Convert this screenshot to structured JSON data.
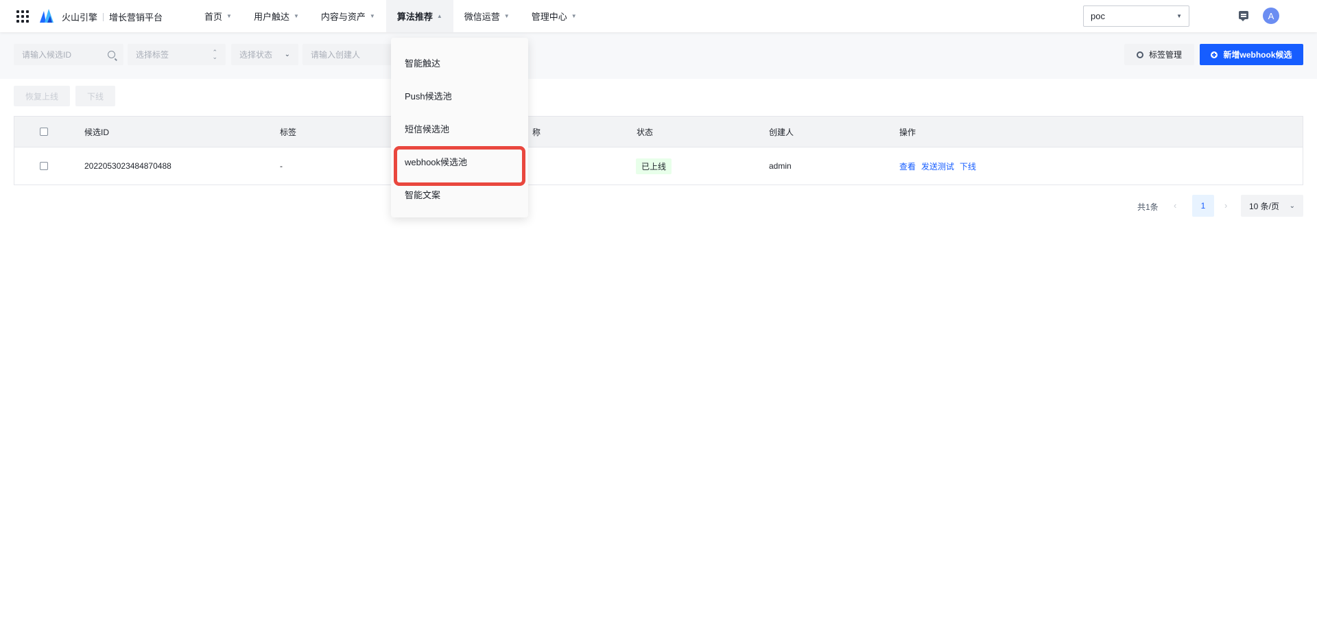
{
  "header": {
    "brand_name": "火山引擎",
    "platform_name": "增长营销平台",
    "nav": [
      {
        "label": "首页"
      },
      {
        "label": "用户触达"
      },
      {
        "label": "内容与资产"
      },
      {
        "label": "算法推荐",
        "active": true
      },
      {
        "label": "微信运营"
      },
      {
        "label": "管理中心"
      }
    ],
    "project_select": "poc",
    "avatar_letter": "A"
  },
  "dropdown": {
    "items": [
      "智能触达",
      "Push候选池",
      "短信候选池",
      "webhook候选池",
      "智能文案"
    ],
    "highlighted_index": 3
  },
  "filters": {
    "candidate_id_placeholder": "请输入候选ID",
    "tag_placeholder": "选择标签",
    "status_placeholder": "选择状态",
    "creator_placeholder": "请输入创建人",
    "tag_manage_label": "标签管理",
    "new_button_label": "新增webhook候选"
  },
  "bulk_actions": {
    "restore_label": "恢复上线",
    "offline_label": "下线"
  },
  "table": {
    "columns": [
      "候选ID",
      "标签",
      "称",
      "状态",
      "创建人",
      "操作"
    ],
    "rows": [
      {
        "id": "2022053023484870488",
        "tag": "-",
        "status_prefix": "已",
        "status_rest": "上线",
        "creator": "admin",
        "actions": [
          "查看",
          "发送测试",
          "下线"
        ]
      }
    ]
  },
  "pagination": {
    "total": "共1条",
    "current_page": "1",
    "page_size": "10 条/页"
  },
  "colors": {
    "primary": "#165dff",
    "highlight_border": "#e9473e",
    "status_online_bg": "#e8ffea"
  }
}
